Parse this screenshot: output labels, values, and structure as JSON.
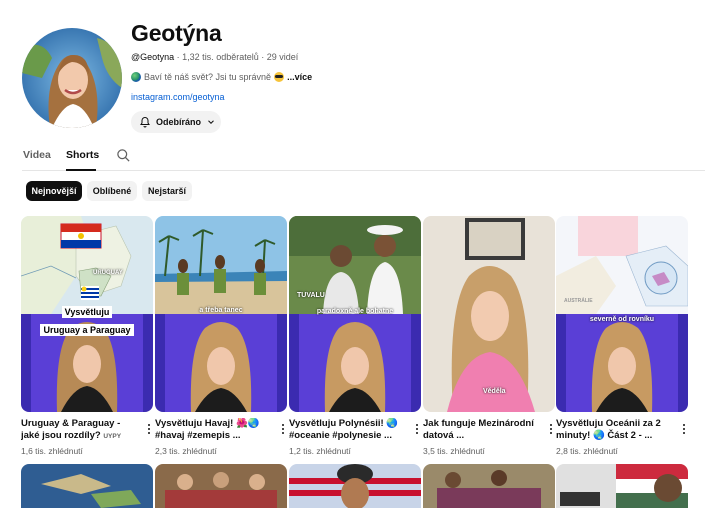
{
  "channel": {
    "title": "Geotýna",
    "handle": "@Geotyna",
    "stats": " · 1,32 tis. odběratelů · 29 videí",
    "description": "Baví tě náš svět? Jsi tu správně",
    "more_label": "...více",
    "link": "instagram.com/geotyna",
    "subscribe_label": "Odebíráno"
  },
  "tabs": [
    {
      "label": "Videa"
    },
    {
      "label": "Shorts"
    }
  ],
  "chips": [
    {
      "label": "Nejnovější"
    },
    {
      "label": "Oblíbené"
    },
    {
      "label": "Nejstarší"
    }
  ],
  "shorts": [
    {
      "title": "Uruguay & Paraguay - jaké jsou rozdíly?",
      "title_suffix": "UYPY",
      "views": "1,6 tis. zhlédnutí",
      "overlay": [
        "Vysvětluju",
        "Uruguay a Paraguay"
      ],
      "map_label": "URUGUAY"
    },
    {
      "title": "Vysvětluju Havaj! 🌺🌏 #havaj #zemepis ...",
      "views": "2,3 tis. zhlédnutí",
      "overlay": "a třeba tanec"
    },
    {
      "title": "Vysvětluju Polynésii! 🌏 #oceanie #polynesie ...",
      "views": "1,2 tis. zhlédnutí",
      "overlay": "paradoxně ale bohatne",
      "map_label": "TUVALU"
    },
    {
      "title": "Jak funguje Mezinárodní datová ...",
      "views": "3,5 tis. zhlédnutí",
      "overlay": "Věděla"
    },
    {
      "title": "Vysvětluju Oceánii za 2 minuty! 🌏 Část 2 - ...",
      "views": "2,8 tis. zhlédnutí",
      "overlay": "severně od rovníku",
      "map_label": "AUSTRÁLIE"
    }
  ]
}
